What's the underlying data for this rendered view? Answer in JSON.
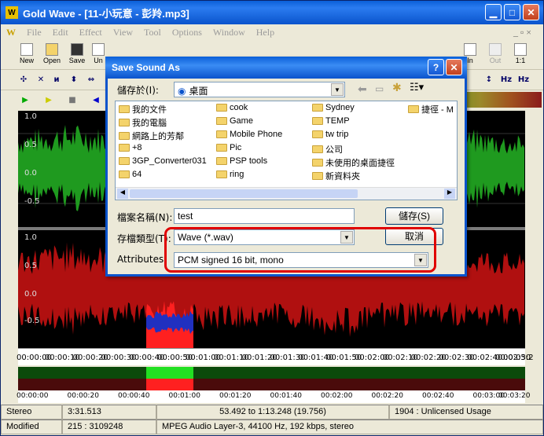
{
  "app": {
    "title": "Gold Wave - [11-小玩意 - 彭羚.mp3]",
    "logo": "W"
  },
  "menu": [
    "File",
    "Edit",
    "Effect",
    "View",
    "Tool",
    "Options",
    "Window",
    "Help"
  ],
  "toolbar": {
    "new": "New",
    "open": "Open",
    "save": "Save",
    "undo": "Un",
    "in": "In",
    "out": "Out",
    "one": "1:1"
  },
  "wave": {
    "ch1_labels": [
      "1.0",
      "0.5",
      "0.0",
      "-0.5"
    ],
    "ch2_labels": [
      "1.0",
      "0.5",
      "0.0",
      "-0.5"
    ]
  },
  "timeline": [
    "00:00:00",
    "00:00:10",
    "00:00:20",
    "00:00:30",
    "00:00:40",
    "00:00:50",
    "00:01:00",
    "00:01:10",
    "00:01:20",
    "00:01:30",
    "00:01:40",
    "00:01:50",
    "00:02:00",
    "00:02:10",
    "00:02:20",
    "00:02:30",
    "00:02:40",
    "00:02:50",
    "00:03:2"
  ],
  "timeline2": [
    "00:00:00",
    "00:00:20",
    "00:00:40",
    "00:01:00",
    "00:01:20",
    "00:01:40",
    "00:02:00",
    "00:02:20",
    "00:02:40",
    "00:03:00",
    "00:03:20"
  ],
  "status1": {
    "mode": "Stereo",
    "length": "3:31.513",
    "selection": "53.492 to 1:13.248 (19.756)",
    "usage": "1904 : Unlicensed Usage"
  },
  "status2": {
    "state": "Modified",
    "pos": "215 : 3109248",
    "format": "MPEG Audio Layer-3, 44100 Hz, 192 kbps, stereo"
  },
  "dialog": {
    "title": "Save Sound As",
    "save_in_label": "儲存於(I):",
    "save_in_value": "桌面",
    "files": [
      "我的文件",
      "我的電腦",
      "網路上的芳鄰",
      "+8",
      "3GP_Converter031",
      "64",
      "cook",
      "Game",
      "Mobile Phone",
      "Pic",
      "PSP tools",
      "ring",
      "Sydney",
      "TEMP",
      "tw trip",
      "公司",
      "未使用的桌面捷徑",
      "新資料夾",
      "捷徑 - M"
    ],
    "filename_label": "檔案名稱(N):",
    "filename_value": "test",
    "filetype_label": "存檔類型(T):",
    "filetype_value": "Wave (*.wav)",
    "attributes_label": "Attributes:",
    "attributes_value": "PCM signed 16 bit, mono",
    "save_button": "儲存(S)",
    "cancel_button": "取消",
    "help": "?",
    "close": "✕"
  },
  "colors": {
    "green_wave": "#1f9a1f",
    "red_wave": "#b01010",
    "selection": "#ff2020",
    "title_blue": "#0a53cc"
  }
}
